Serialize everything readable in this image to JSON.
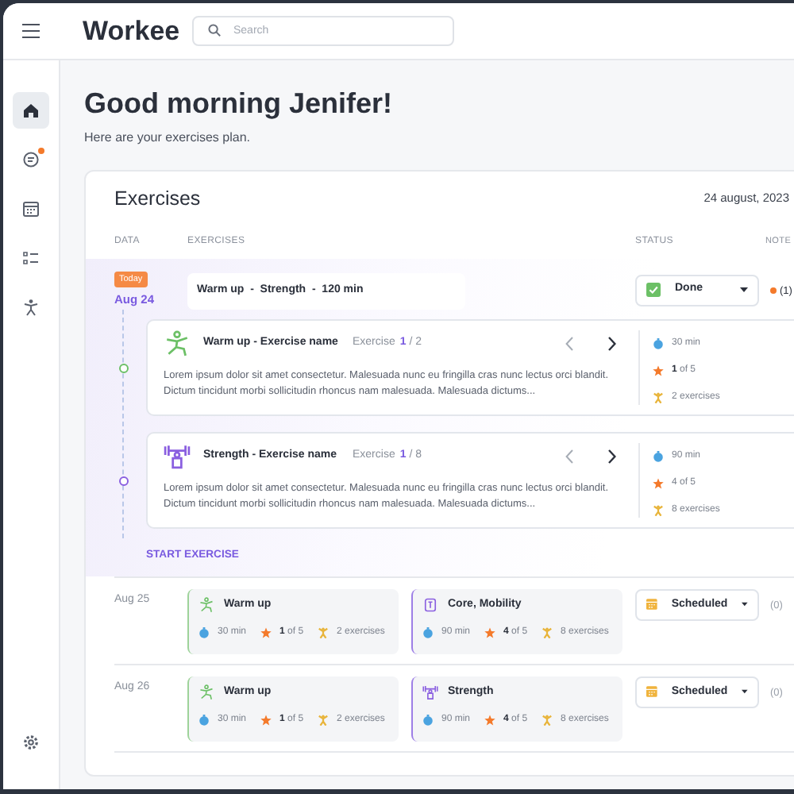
{
  "brand": "Workee",
  "search": {
    "placeholder": "Search"
  },
  "sidebar": {
    "items": [
      {
        "kind": "home",
        "selected": true,
        "notification": false
      },
      {
        "kind": "chat",
        "selected": false,
        "notification": true
      },
      {
        "kind": "calendar",
        "selected": false,
        "notification": false
      },
      {
        "kind": "list",
        "selected": false,
        "notification": false
      },
      {
        "kind": "exercise",
        "selected": false,
        "notification": false
      }
    ]
  },
  "greeting": "Good morning Jenifer!",
  "subtitle": "Here are your exercises plan.",
  "exercises": {
    "title": "Exercises",
    "date": "24 august, 2023",
    "columns": [
      "DATA",
      "EXERCISES",
      "STATUS",
      "NOTE"
    ],
    "today": {
      "badge": "Today",
      "date": "Aug 24",
      "summary": "Warm up  -  Strength  -  120 min",
      "status": {
        "kind": "done",
        "label": "Done"
      },
      "note": {
        "count": "(1)",
        "unread": true
      },
      "details": [
        {
          "kind": "warmup",
          "title": "Warm up - Exercise name",
          "counter_label": "Exercise",
          "current": "1",
          "total": "/ 2",
          "prev_enabled": false,
          "next_enabled": true,
          "description": "Lorem ipsum dolor sit amet consectetur. Malesuada nunc eu fringilla cras nunc lectus orci blandit. Dictum tincidunt morbi sollicitudin rhoncus nam malesuada. Malesuada dictums...",
          "duration": "30 min",
          "rating": "**1** of 5",
          "count": "2 exercises"
        },
        {
          "kind": "strength",
          "title": "Strength - Exercise name",
          "counter_label": "Exercise",
          "current": "1",
          "total": "/ 8",
          "prev_enabled": false,
          "next_enabled": true,
          "description": "Lorem ipsum dolor sit amet consectetur. Malesuada nunc eu fringilla cras nunc lectus orci blandit. Dictum tincidunt morbi sollicitudin rhoncus nam malesuada. Malesuada dictums...",
          "duration": "90 min",
          "rating": "4 of 5",
          "count": "8 exercises"
        }
      ],
      "action": "START EXERCISE"
    },
    "rows": [
      {
        "date": "Aug 25",
        "status": {
          "kind": "scheduled",
          "label": "Scheduled"
        },
        "note": {
          "count": "(0)",
          "unread": false
        },
        "items": [
          {
            "kind": "warmup",
            "title": "Warm up",
            "duration": "30 min",
            "rating": "**1** of 5",
            "count": "2 exercises"
          },
          {
            "kind": "core",
            "title": "Core, Mobility",
            "duration": "90 min",
            "rating": "**4** of 5",
            "count": "8 exercises"
          }
        ]
      },
      {
        "date": "Aug 26",
        "status": {
          "kind": "scheduled",
          "label": "Scheduled"
        },
        "note": {
          "count": "(0)",
          "unread": false
        },
        "items": [
          {
            "kind": "warmup",
            "title": "Warm up",
            "duration": "30 min",
            "rating": "**1** of 5",
            "count": "2 exercises"
          },
          {
            "kind": "strength",
            "title": "Strength",
            "duration": "90 min",
            "rating": "**4** of 5",
            "count": "8 exercises"
          }
        ]
      }
    ]
  }
}
